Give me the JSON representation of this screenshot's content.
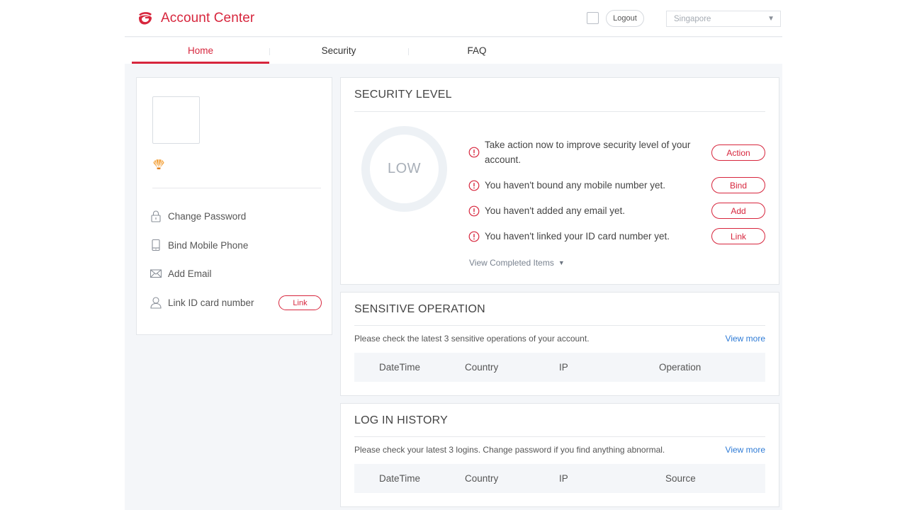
{
  "header": {
    "brand_title": "Account Center",
    "logout_label": "Logout",
    "region_value": "Singapore",
    "brand_color": "#d7263d"
  },
  "nav": {
    "tabs": [
      {
        "label": "Home",
        "active": true
      },
      {
        "label": "Security",
        "active": false
      },
      {
        "label": "FAQ",
        "active": false
      }
    ]
  },
  "sidebar": {
    "items": [
      {
        "label": "Change Password",
        "icon": "lock-icon"
      },
      {
        "label": "Bind Mobile Phone",
        "icon": "mobile-phone-icon"
      },
      {
        "label": "Add Email",
        "icon": "envelope-icon"
      },
      {
        "label": "Link ID card number",
        "icon": "user-icon"
      }
    ],
    "link_button": "Link"
  },
  "security": {
    "title": "SECURITY LEVEL",
    "level": "LOW",
    "rows": [
      {
        "text": "Take action now to improve security level of your account.",
        "button": "Action"
      },
      {
        "text": "You haven't bound any mobile number yet.",
        "button": "Bind"
      },
      {
        "text": "You haven't added any email yet.",
        "button": "Add"
      },
      {
        "text": "You haven't linked your ID card number yet.",
        "button": "Link"
      }
    ],
    "view_completed": "View Completed Items"
  },
  "sensitive": {
    "title": "SENSITIVE OPERATION",
    "subtitle": "Please check the latest 3 sensitive operations of your account.",
    "view_more": "View more",
    "columns": [
      "DateTime",
      "Country",
      "IP",
      "Operation"
    ]
  },
  "login_history": {
    "title": "LOG IN HISTORY",
    "subtitle": "Please check your latest 3 logins. Change password if you find anything abnormal.",
    "view_more": "View more",
    "columns": [
      "DateTime",
      "Country",
      "IP",
      "Source"
    ]
  }
}
